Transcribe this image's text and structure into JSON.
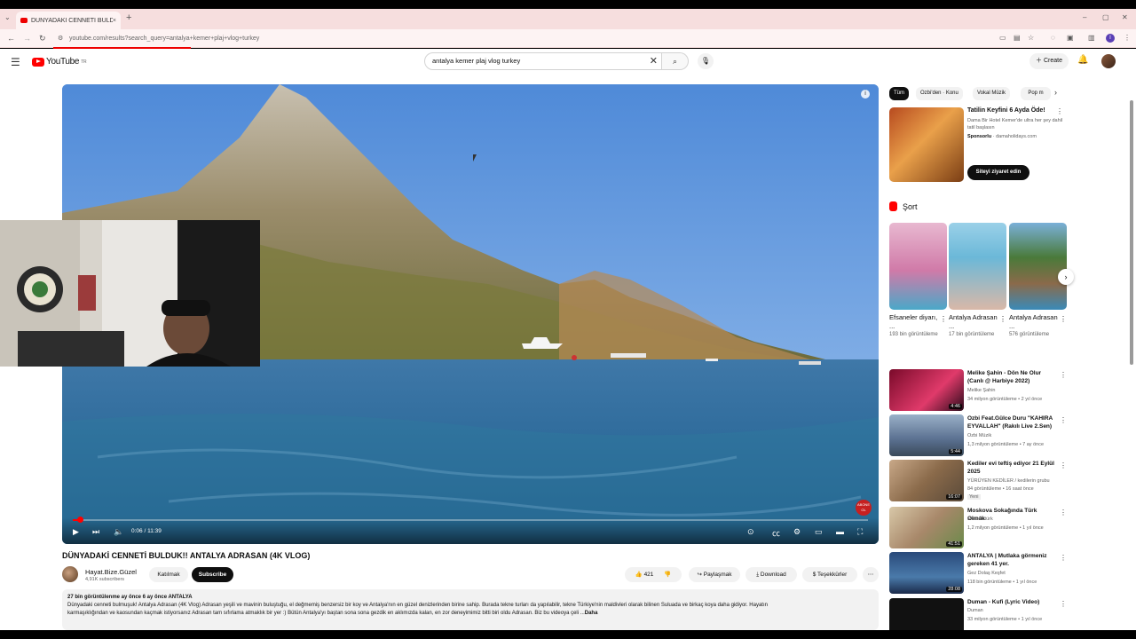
{
  "browser": {
    "tab_title": "DÜNYADAKİ CENNETİ BULDUK!",
    "tab_close": "×",
    "new_tab": "+",
    "url": "youtube.com/results?search_query=antalya+kemer+plaj+vlog+turkey",
    "profile_initial": "I"
  },
  "youtube": {
    "logo_text": "YouTube",
    "logo_region": "TR",
    "search_value": "antalya kemer plaj vlog turkey",
    "create_label": "Create"
  },
  "player": {
    "time": "0:06 / 11:39",
    "progress": 0.009,
    "watermark": "ABONE OL"
  },
  "video": {
    "title": "DÜNYADAKİ CENNETİ BULDUK!! ANTALYA ADRASAN (4K VLOG)",
    "channel": "Hayat.Bize.Güzel",
    "subscribers": "4,91K subscribers",
    "join_label": "Katılmak",
    "subscribe_label": "Subscribe",
    "likes": "421",
    "share_label": "Paylaşmak",
    "download_label": "Download",
    "thanks_label": "Teşekkürler",
    "meta": "27 bin görüntülenme  ay önce  6 ay önce  ANTALYA",
    "description_1": "Dünyadaki cenneti bulmuşuk! Antalya Adrasan (4K Vlog) Adrasan yeşili ve mavinin buluştuğu, el değmemiş benzersiz bir koy ve Antalya'nın en güzel denizlerinden birine sahip. Burada tekne turları da yapılabilir, tekne Türkiye'nin maldivleri olarak bilinen Suluada ve birkaç koya daha gidiyor. Hayatın",
    "description_2": "karmaşıklığından ve kaosundan kaçmak istiyorsanız Adrasan tam sıfırlama atmaklık bir yer :) Bütün Antalya'yı baştan sona sona gezdik en aklımızda kalan, en zor deneyimimiz bitti biri oldu Adrasan. Biz bu videoya çeli ...",
    "more_label": "Daha"
  },
  "chips": [
    "Tüm",
    "Ozbi'den · Konu",
    "Vokal Müzik",
    "Pop m"
  ],
  "ad": {
    "title": "Tatilin Keyfini 6 Ayda Öde!",
    "desc": "Dama Bir Hotel Kemer'de ultra her şey dahil tatil başlasın",
    "sponsor": "Sponsorlu",
    "domain": "damaholidays.com",
    "cta": "Siteyi ziyaret edin"
  },
  "shorts": {
    "heading": "Şort",
    "items": [
      {
        "title": "Efsaneler diyarı, ...",
        "views": "193 bin görüntüleme"
      },
      {
        "title": "Antalya Adrasan ...",
        "views": "17 bin görüntüleme"
      },
      {
        "title": "Antalya Adrasan ...",
        "views": "576 görüntüleme"
      }
    ]
  },
  "recs": [
    {
      "title": "Melike Şahin - Dön Ne Olur (Canlı @ Harbiye 2022)",
      "channel": "Melike Şahin",
      "meta": "34 milyon görüntüleme • 2 yıl önce",
      "duration": "4:46"
    },
    {
      "title": "Ozbi Feat.Gülce Duru \"KAHIRA EYVALLAH\" (Rakılı Live 2.Sen)",
      "channel": "Ozbi Müzik",
      "meta": "1,3 milyon görüntüleme • 7 ay önce",
      "duration": "5:44"
    },
    {
      "title": "Kediler evi teftiş ediyor 21 Eylül 2025",
      "channel": "YÜRÜYEN KEDİLER / kedilerin grubu",
      "meta": "84 görüntüleme • 16 saat önce",
      "badge": "Yeni",
      "duration": "16:07"
    },
    {
      "title": "Moskova Sokağında Türk Olmak",
      "channel": "Mert Öztürk",
      "meta": "1,2 milyon görüntüleme • 1 yıl önce",
      "duration": "41:51"
    },
    {
      "title": "ANTALYA | Mutlaka görmeniz gereken 41 yer.",
      "channel": "Gez Dolaş Keşfet",
      "meta": "118 bin görüntüleme • 1 yıl önce",
      "duration": "28:08"
    },
    {
      "title": "Duman - Kufi (Lyric Video)",
      "channel": "Duman",
      "meta": "33 milyon görüntüleme • 1 yıl önce",
      "duration": ""
    }
  ]
}
